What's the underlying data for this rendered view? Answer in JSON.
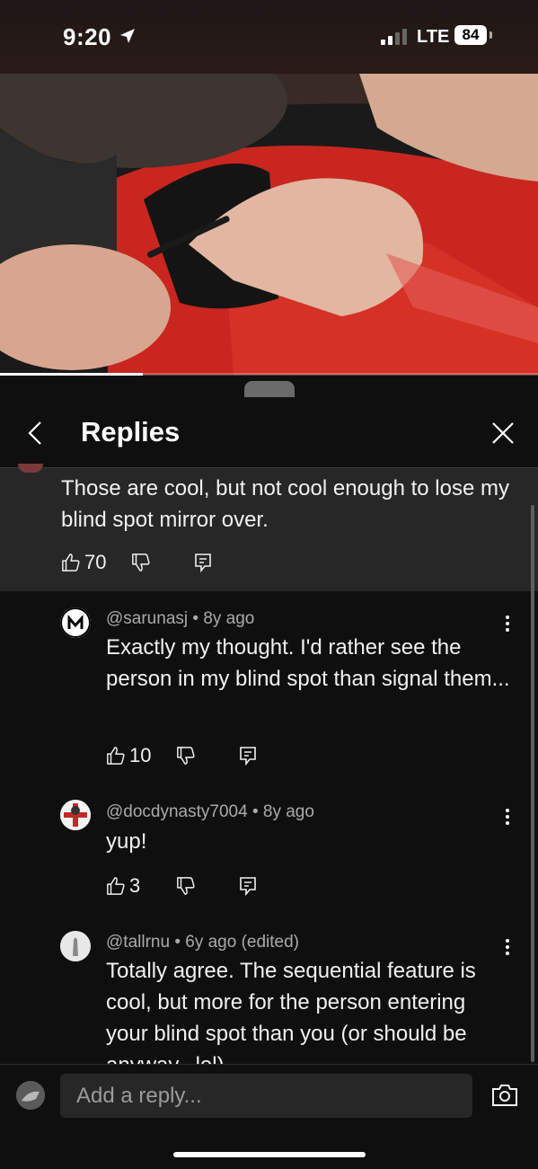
{
  "status_bar": {
    "time": "9:20",
    "network": "LTE",
    "battery": "84"
  },
  "video": {
    "progress": 0.265
  },
  "header": {
    "title": "Replies"
  },
  "parent_comment": {
    "text": "Those are cool, but not cool enough to lose my blind spot mirror over.",
    "likes": "70"
  },
  "replies": [
    {
      "author": "@sarunasj",
      "time": "8y ago",
      "text": "Exactly my thought. I'd rather see the person in my blind spot than signal them...",
      "likes": "10"
    },
    {
      "author": "@docdynasty7004",
      "time": "8y ago",
      "text": "yup!",
      "likes": "3"
    },
    {
      "author": "@tallrnu",
      "time": "6y ago (edited)",
      "text": "Totally agree. The sequential feature is cool, but more for the person entering your blind spot than you (or should be anyway...lol)"
    }
  ],
  "composer": {
    "placeholder": "Add a reply..."
  },
  "icons": {
    "like": "thumbs-up-icon",
    "dislike": "thumbs-down-icon",
    "reply": "reply-icon",
    "back": "chevron-left-icon",
    "close": "close-icon",
    "camera": "camera-icon",
    "more": "more-vertical-icon"
  }
}
